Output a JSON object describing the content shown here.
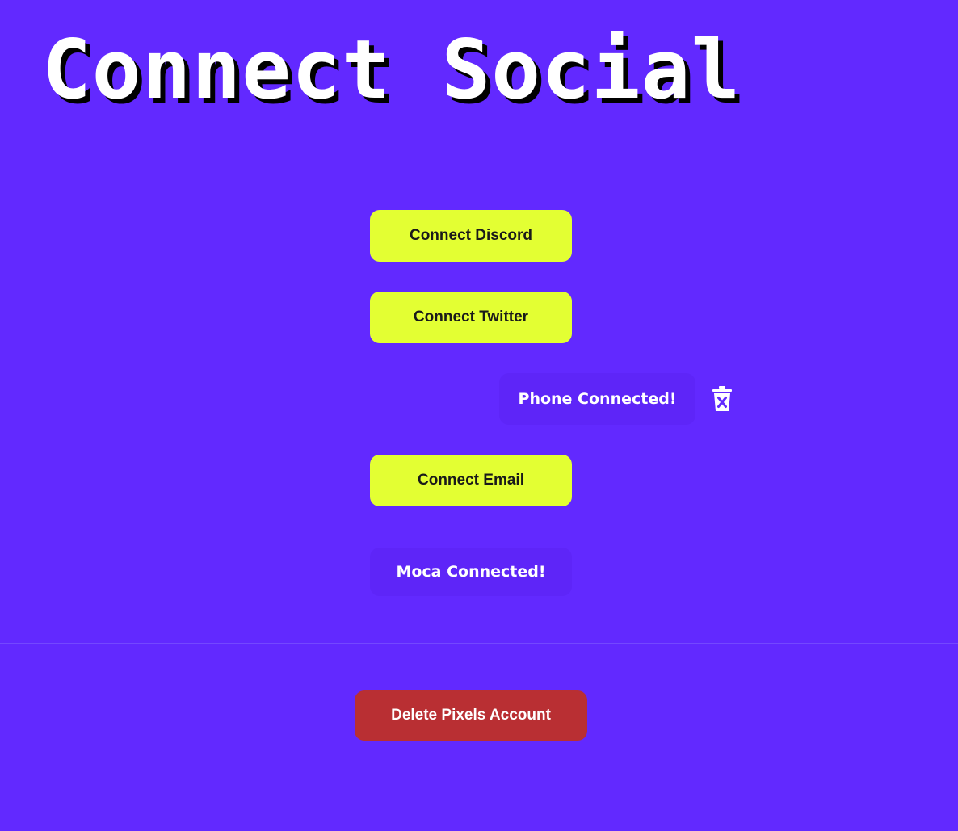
{
  "page": {
    "title": "Connect Social"
  },
  "buttons": {
    "discord": "Connect Discord",
    "twitter": "Connect Twitter",
    "email": "Connect Email",
    "delete_account": "Delete Pixels Account"
  },
  "status": {
    "phone": "Phone Connected!",
    "moca": "Moca Connected!"
  },
  "icons": {
    "remove_phone": "trash-x-icon"
  },
  "colors": {
    "background": "#6229ff",
    "connect_button": "#e3ff33",
    "status_pill": "#5e25f8",
    "danger_button": "#b92f33",
    "title_text": "#ffffff",
    "title_shadow": "#000000"
  }
}
